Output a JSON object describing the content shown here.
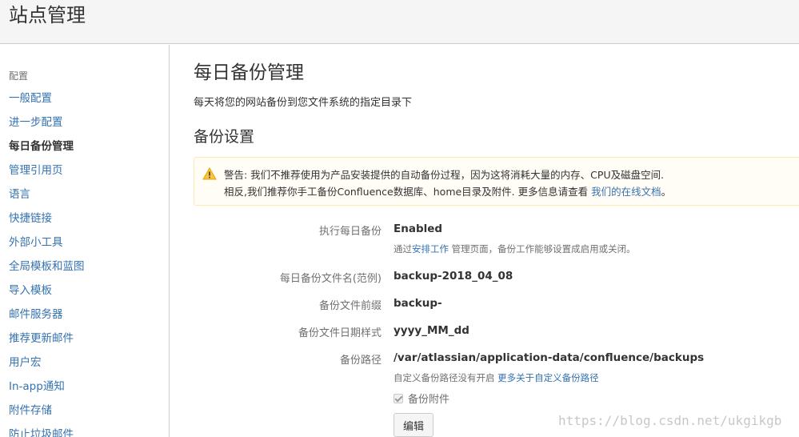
{
  "header": {
    "title": "站点管理"
  },
  "sidebar": {
    "section_label": "配置",
    "items": [
      {
        "label": "一般配置"
      },
      {
        "label": "进一步配置"
      },
      {
        "label": "每日备份管理"
      },
      {
        "label": "管理引用页"
      },
      {
        "label": "语言"
      },
      {
        "label": "快捷链接"
      },
      {
        "label": "外部小工具"
      },
      {
        "label": "全局模板和蓝图"
      },
      {
        "label": "导入模板"
      },
      {
        "label": "邮件服务器"
      },
      {
        "label": "推荐更新邮件"
      },
      {
        "label": "用户宏"
      },
      {
        "label": "In-app通知"
      },
      {
        "label": "附件存储"
      },
      {
        "label": "防止垃圾邮件"
      }
    ],
    "active_index": 2
  },
  "main": {
    "title": "每日备份管理",
    "description": "每天将您的网站备份到您文件系统的指定目录下",
    "section_title": "备份设置",
    "warning": {
      "line1": "警告: 我们不推荐使用为产品安装提供的自动备份过程，因为这将消耗大量的内存、CPU及磁盘空间.",
      "line2_prefix": "相反,我们推荐你手工备份Confluence数据库、home目录及附件. 更多信息请查看 ",
      "line2_link": "我们的在线文档",
      "line2_suffix": "。"
    },
    "settings": {
      "daily_backup": {
        "label": "执行每日备份",
        "value": "Enabled",
        "help_prefix": "通过",
        "help_link": "安排工作",
        "help_suffix": " 管理页面，备份工作能够设置成启用或关闭。"
      },
      "filename_example": {
        "label": "每日备份文件名(范例)",
        "value": "backup-2018_04_08"
      },
      "file_prefix": {
        "label": "备份文件前缀",
        "value": "backup-"
      },
      "date_pattern": {
        "label": "备份文件日期样式",
        "value": "yyyy_MM_dd"
      },
      "backup_path": {
        "label": "备份路径",
        "value": "/var/atlassian/application-data/confluence/backups",
        "help_prefix": "自定义备份路径没有开启 ",
        "help_link": "更多关于自定义备份路径"
      },
      "backup_attachments": {
        "label": "备份附件",
        "checked": true
      }
    },
    "edit_button": "编辑"
  },
  "watermark": "https://blog.csdn.net/ukgikgb",
  "colors": {
    "link": "#3572b0",
    "warning_bg": "#fffdf6",
    "warning_border": "#ffeaae",
    "warning_icon": "#f6c342"
  }
}
